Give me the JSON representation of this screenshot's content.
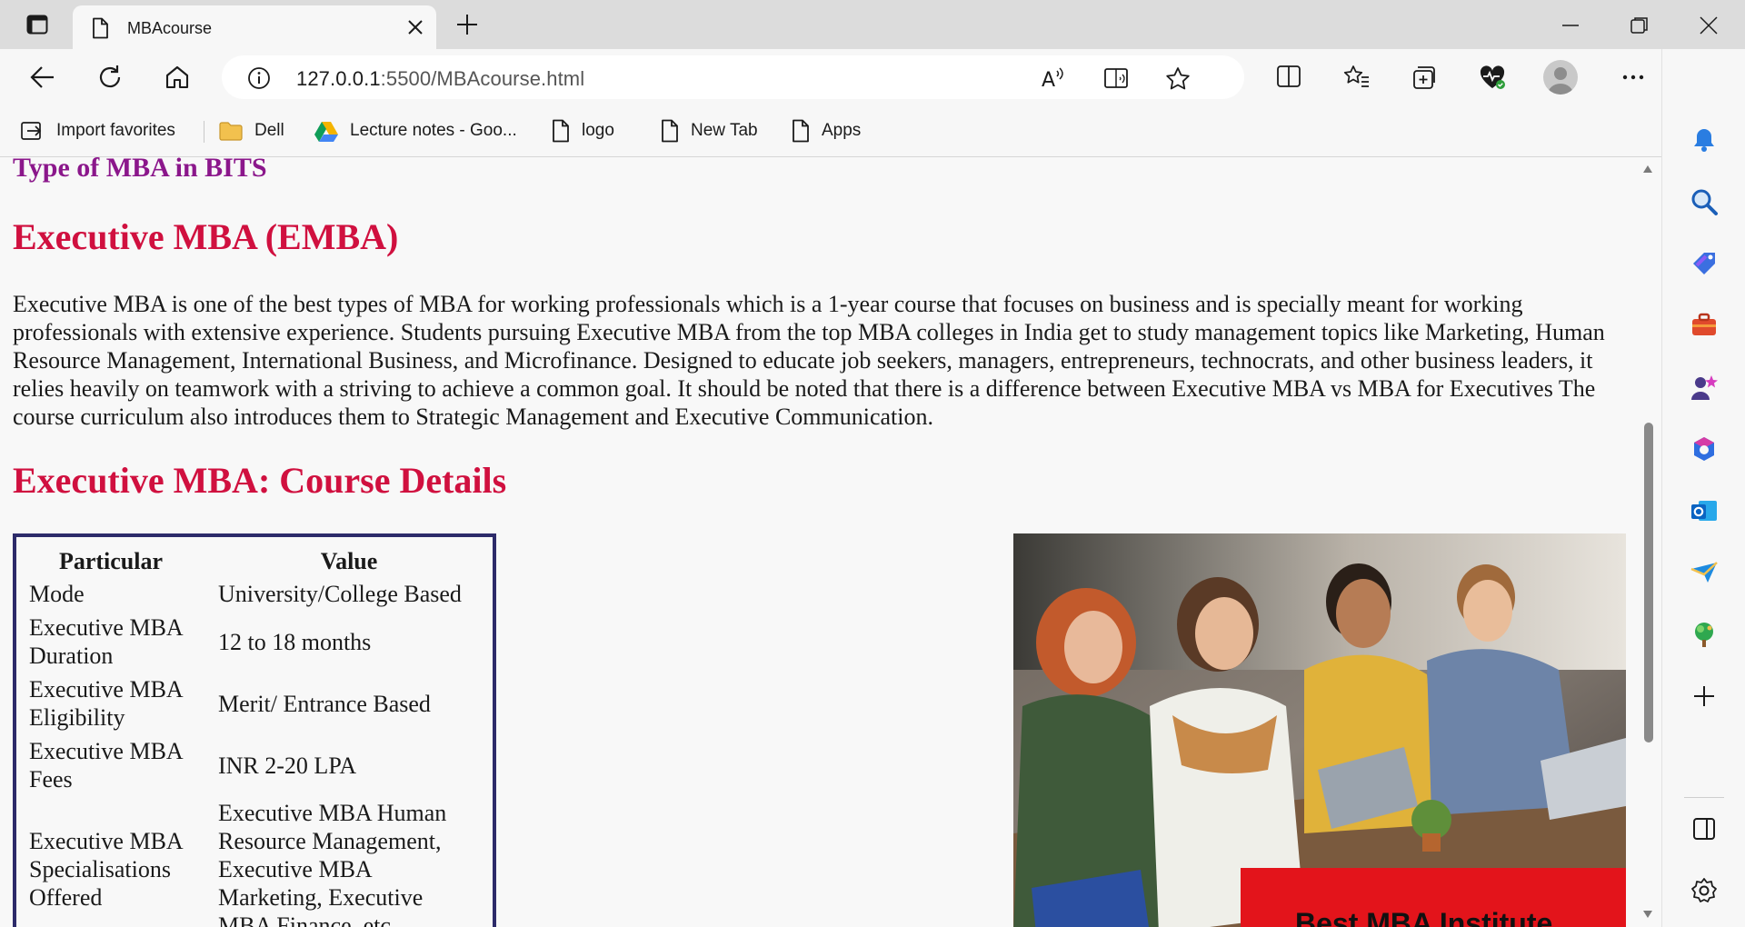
{
  "browser": {
    "tab": {
      "title": "MBAcourse"
    },
    "address": {
      "host": "127.0.0.1",
      "port_path": ":5500/MBAcourse.html"
    },
    "favorites": [
      {
        "label": "Import favorites",
        "icon": "import-favorites-icon"
      },
      {
        "label": "Dell",
        "icon": "folder-icon"
      },
      {
        "label": "Lecture notes - Goo...",
        "icon": "google-drive-icon"
      },
      {
        "label": "logo",
        "icon": "page-icon"
      },
      {
        "label": "New Tab",
        "icon": "page-icon"
      },
      {
        "label": "Apps",
        "icon": "page-icon"
      }
    ],
    "toolbar_icons": [
      "back-icon",
      "refresh-icon",
      "home-icon",
      "read-aloud-icon",
      "immersive-reader-icon",
      "favorite-star-icon",
      "split-screen-icon",
      "favorites-icon",
      "collections-icon",
      "browser-essentials-icon",
      "profile-avatar",
      "more-icon",
      "bing-icon"
    ],
    "sidebar_icons": [
      "notifications-icon",
      "search-icon",
      "shopping-icon",
      "tools-icon",
      "games-icon",
      "microsoft-365-icon",
      "outlook-icon",
      "drop-icon",
      "tree-icon",
      "add-icon",
      "sidebar-toggle-icon",
      "settings-icon"
    ]
  },
  "page": {
    "heading_bits": "Type of MBA in BITS",
    "heading_emba": "Executive MBA (EMBA)",
    "paragraph": "Executive MBA is one of the best types of MBA for working professionals which is a 1-year course that focuses on business and is specially meant for working professionals with extensive experience. Students pursuing Executive MBA from the top MBA colleges in India get to study management topics like Marketing, Human Resource Management, International Business, and Microfinance. Designed to educate job seekers, managers, entrepreneurs, technocrats, and other business leaders, it relies heavily on teamwork with a striving to achieve a common goal. It should be noted that there is a difference between Executive MBA vs MBA for Executives The course curriculum also introduces them to Strategic Management and Executive Communication.",
    "heading_details": "Executive MBA: Course Details",
    "table": {
      "headers": [
        "Particular",
        "Value"
      ],
      "rows": [
        [
          "Mode",
          "University/College Based"
        ],
        [
          "Executive MBA Duration",
          "12 to 18 months"
        ],
        [
          "Executive MBA Eligibility",
          "Merit/ Entrance Based"
        ],
        [
          "Executive MBA Fees",
          "INR 2-20 LPA"
        ],
        [
          "Executive MBA Specialisations Offered",
          "Executive MBA Human Resource Management, Executive MBA Marketing, Executive MBA Finance, etc"
        ]
      ]
    },
    "image": {
      "banner_text": "Best MBA Institute",
      "banner_color": "#e3141b"
    }
  },
  "colors": {
    "heading_purple": "#8b178b",
    "heading_red": "#d0103f",
    "table_border": "#2d2b6a"
  }
}
